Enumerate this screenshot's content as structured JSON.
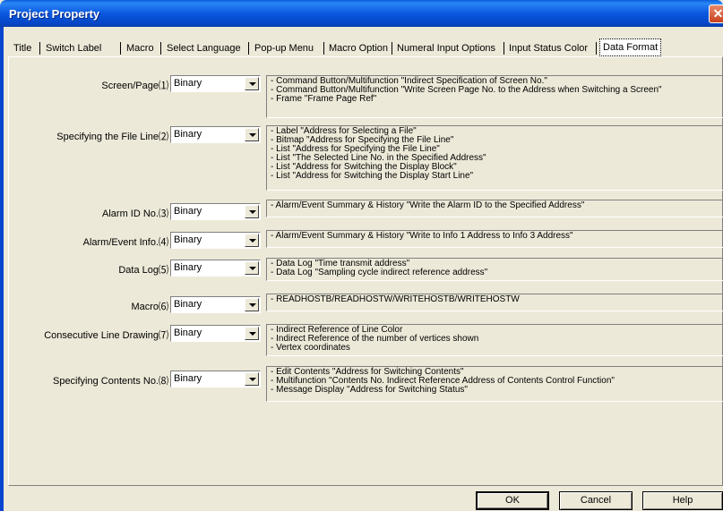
{
  "window": {
    "title": "Project Property",
    "close_glyph": "✕"
  },
  "tabs": [
    {
      "label": "Title"
    },
    {
      "label": "Switch Label"
    },
    {
      "label": "Macro"
    },
    {
      "label": "Select Language"
    },
    {
      "label": "Pop-up Menu"
    },
    {
      "label": "Macro Option"
    },
    {
      "label": "Numeral Input Options"
    },
    {
      "label": "Input Status Color"
    },
    {
      "label": "Data Format",
      "active": true
    }
  ],
  "rows": [
    {
      "label": "Screen/Page⑴",
      "value": "Binary",
      "desc": [
        "- Command Button/Multifunction \"Indirect Specification of Screen No.\"",
        "- Command Button/Multifunction \"Write Screen Page No. to the Address when Switching a Screen\"",
        "- Frame \"Frame Page Ref\""
      ]
    },
    {
      "label": "Specifying the File Line⑵",
      "value": "Binary",
      "desc": [
        "- Label \"Address for Selecting a File\"",
        "- Bitmap \"Address for Specifying the File Line\"",
        "- List \"Address for Specifying the File Line\"",
        "- List \"The Selected Line No. in the Specified Address\"",
        "- List \"Address for Switching the Display Block\"",
        "- List \"Address for Switching the Display Start Line\""
      ]
    },
    {
      "label": "Alarm ID No.⑶",
      "value": "Binary",
      "desc": [
        "- Alarm/Event Summary & History \"Write the Alarm ID to the Specified Address\""
      ]
    },
    {
      "label": "Alarm/Event Info.⑷",
      "value": "Binary",
      "desc": [
        "- Alarm/Event Summary & History \"Write to Info 1 Address to Info 3 Address\""
      ]
    },
    {
      "label": "Data Log⑸",
      "value": "Binary",
      "desc": [
        "- Data Log \"Time transmit address\"",
        "- Data Log \"Sampling cycle indirect reference address\""
      ]
    },
    {
      "label": "Macro⑹",
      "value": "Binary",
      "desc": [
        "- READHOSTB/READHOSTW/WRITEHOSTB/WRITEHOSTW"
      ]
    },
    {
      "label": "Consecutive Line Drawing⑺",
      "value": "Binary",
      "desc": [
        "- Indirect Reference of Line Color",
        "- Indirect Reference of the number of vertices shown",
        "- Vertex coordinates"
      ]
    },
    {
      "label": "Specifying Contents No.⑻",
      "value": "Binary",
      "desc": [
        "- Edit Contents \"Address for Switching Contents\"",
        "- Multifunction \"Contents No. Indirect Reference Address of Contents Control Function\"",
        "- Message Display \"Address for Switching Status\""
      ]
    }
  ],
  "buttons": {
    "ok": "OK",
    "cancel": "Cancel",
    "help": "Help"
  }
}
